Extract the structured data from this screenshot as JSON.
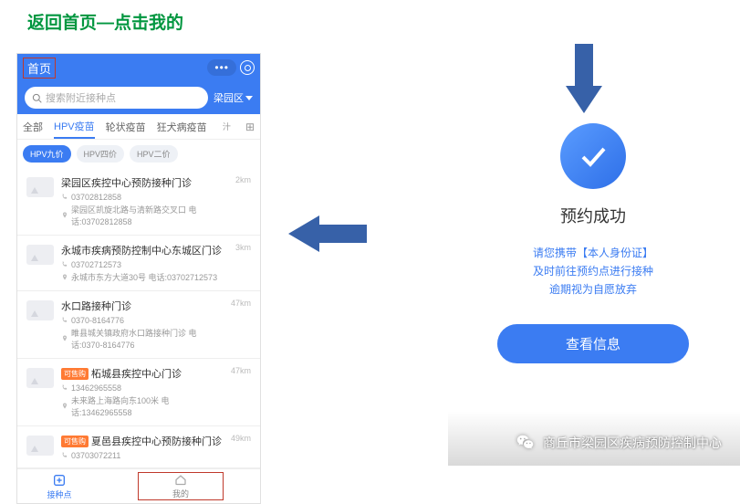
{
  "title": "返回首页—点击我的",
  "phone": {
    "header_title": "首页",
    "search_placeholder": "搜索附近接种点",
    "region": "梁园区",
    "tabs": [
      "全部",
      "HPV疫苗",
      "轮状疫苗",
      "狂犬病疫苗"
    ],
    "more": "汁",
    "pills": [
      {
        "label": "HPV九价",
        "on": true
      },
      {
        "label": "HPV四价",
        "on": false
      },
      {
        "label": "HPV二价",
        "on": false
      }
    ],
    "clinics": [
      {
        "name": "梁园区疾控中心预防接种门诊",
        "dist": "2km",
        "phone": "0370281285­8",
        "addr": "梁园区凯旋北路与清新路交叉口 电话:03702812858"
      },
      {
        "name": "永城市疾病预防控制中心东城区门诊",
        "dist": "3km",
        "phone": "03702712573",
        "addr": "永城市东方大道30号 电话:03702712573"
      },
      {
        "name": "水口路接种门诊",
        "dist": "47km",
        "phone": "0370-8164776",
        "addr": "睢县城关镇政府水口路接种门诊 电话:0370-8164776"
      },
      {
        "badge": "可售购",
        "name": "柘城县疾控中心门诊",
        "dist": "47km",
        "phone": "13462965558",
        "addr": "未来路上海路向东100米 电话:13462965558"
      },
      {
        "badge": "可售购",
        "name": "夏邑县疾控中心预防接种门诊",
        "dist": "49km",
        "phone": "0370307221­1",
        "addr": ""
      }
    ],
    "bottom": [
      {
        "label": "接种点"
      },
      {
        "label": "我的"
      }
    ]
  },
  "success": {
    "title": "预约成功",
    "lines": [
      "请您携带【本人身份证】",
      "及时前往预约点进行接种",
      "逾期视为自愿放弃"
    ],
    "button": "查看信息"
  },
  "wechat": "商丘市梁园区疾病预防控制中心"
}
